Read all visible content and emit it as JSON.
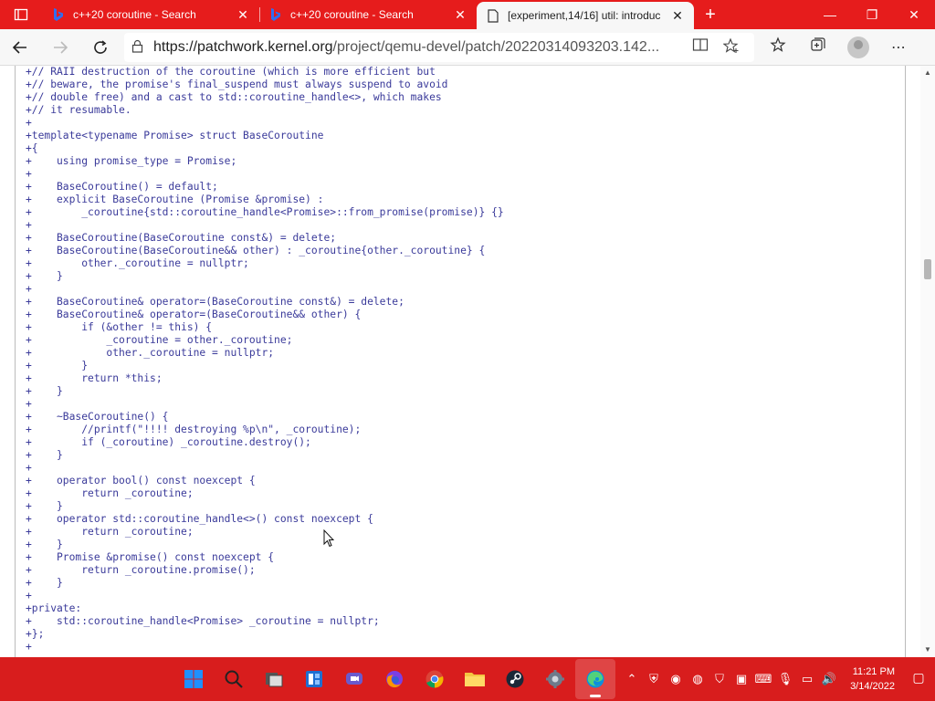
{
  "browser": {
    "tabs": [
      {
        "title": "c++20 coroutine - Search",
        "icon": "bing-icon",
        "active": false
      },
      {
        "title": "c++20 coroutine - Search",
        "icon": "bing-icon",
        "active": false
      },
      {
        "title": "[experiment,14/16] util: introduc",
        "icon": "page-icon",
        "active": true
      }
    ],
    "new_tab": "+",
    "url_host": "https://patchwork.kernel.org",
    "url_path": "/project/qemu-devel/patch/20220314093203.142..."
  },
  "code_lines": [
    "+// RAII destruction of the coroutine (which is more efficient but",
    "+// beware, the promise's final_suspend must always suspend to avoid",
    "+// double free) and a cast to std::coroutine_handle<>, which makes",
    "+// it resumable.",
    "+",
    "+template<typename Promise> struct BaseCoroutine",
    "+{",
    "+    using promise_type = Promise;",
    "+",
    "+    BaseCoroutine() = default;",
    "+    explicit BaseCoroutine (Promise &promise) :",
    "+        _coroutine{std::coroutine_handle<Promise>::from_promise(promise)} {}",
    "+",
    "+    BaseCoroutine(BaseCoroutine const&) = delete;",
    "+    BaseCoroutine(BaseCoroutine&& other) : _coroutine{other._coroutine} {",
    "+        other._coroutine = nullptr;",
    "+    }",
    "+",
    "+    BaseCoroutine& operator=(BaseCoroutine const&) = delete;",
    "+    BaseCoroutine& operator=(BaseCoroutine&& other) {",
    "+        if (&other != this) {",
    "+            _coroutine = other._coroutine;",
    "+            other._coroutine = nullptr;",
    "+        }",
    "+        return *this;",
    "+    }",
    "+",
    "+    ~BaseCoroutine() {",
    "+        //printf(\"!!!! destroying %p\\n\", _coroutine);",
    "+        if (_coroutine) _coroutine.destroy();",
    "+    }",
    "+",
    "+    operator bool() const noexcept {",
    "+        return _coroutine;",
    "+    }",
    "+    operator std::coroutine_handle<>() const noexcept {",
    "+        return _coroutine;",
    "+    }",
    "+    Promise &promise() const noexcept {",
    "+        return _coroutine.promise();",
    "+    }",
    "+",
    "+private:",
    "+    std::coroutine_handle<Promise> _coroutine = nullptr;",
    "+};",
    "+"
  ],
  "taskbar": {
    "apps": [
      "start-icon",
      "search-icon",
      "task-view-icon",
      "widgets-icon",
      "chat-icon",
      "firefox-icon",
      "chrome-icon",
      "file-explorer-icon",
      "steam-icon",
      "settings-icon",
      "edge-icon"
    ],
    "time": "11:21 PM",
    "date": "3/14/2022"
  },
  "colors": {
    "accent": "#e61c1c",
    "taskbar": "#d81d1d",
    "code_text": "#3a3a9a"
  }
}
